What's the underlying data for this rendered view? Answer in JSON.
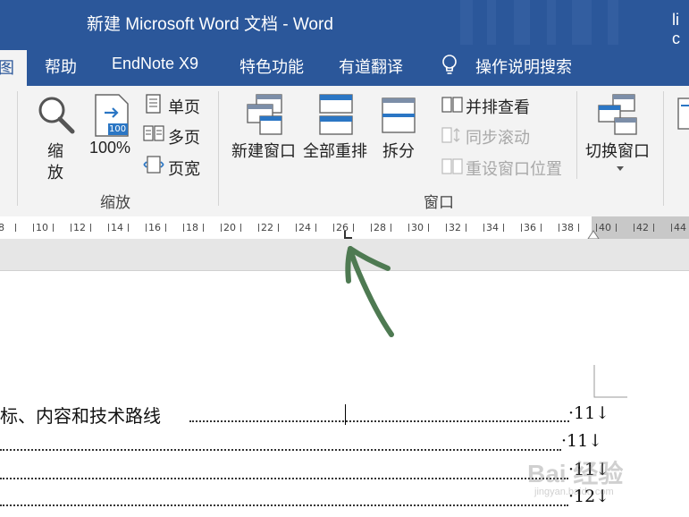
{
  "titlebar": {
    "title": "新建 Microsoft Word 文档  -  Word",
    "user": "li c"
  },
  "tabs": {
    "partial": "图",
    "items": [
      "帮助",
      "EndNote X9",
      "特色功能",
      "有道翻译"
    ],
    "search": "操作说明搜索"
  },
  "ribbon": {
    "zoom_group": {
      "zoom": "缩放",
      "zoom_char1": "缩",
      "zoom_char2": "放",
      "hundred": "100%",
      "badge": "100",
      "single_page": "单页",
      "multi_page": "多页",
      "page_width": "页宽"
    },
    "window_group": {
      "new_window": "新建窗口",
      "arrange_all": "全部重排",
      "split": "拆分",
      "side_by_side": "并排查看",
      "sync_scroll": "同步滚动",
      "reset_position": "重设窗口位置",
      "switch_window": "切换窗口",
      "group_label": "窗口"
    }
  },
  "ruler": {
    "ticks": [
      "8",
      "10",
      "12",
      "14",
      "16",
      "18",
      "20",
      "22",
      "24",
      "26",
      "28",
      "30",
      "32",
      "34",
      "36",
      "38",
      "40",
      "42",
      "44"
    ]
  },
  "document": {
    "toc_line_1": "标、内容和技术路线",
    "page_numbers": [
      "·11↓",
      "·11↓",
      "·11↓",
      "·12↓"
    ]
  },
  "watermark": {
    "text": "Bai 经验",
    "sub": "jingyan.baidu.com"
  }
}
